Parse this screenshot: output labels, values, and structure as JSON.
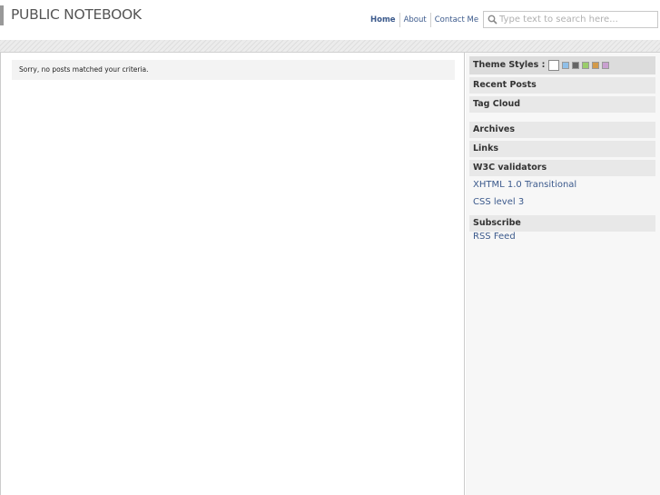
{
  "header": {
    "site_title": "PUBLIC NOTEBOOK",
    "nav": [
      "Home",
      "About",
      "Contact Me"
    ],
    "search_placeholder": "Type text to search here..."
  },
  "content": {
    "notice": "Sorry, no posts matched your criteria."
  },
  "sidebar": {
    "theme_label": "Theme Styles :",
    "theme_swatches": [
      "#ffffff",
      "#8fbfe8",
      "#666666",
      "#9acd6a",
      "#d39a4a",
      "#c9a0d0"
    ],
    "recent_posts": "Recent Posts",
    "tag_cloud": "Tag Cloud",
    "archives": "Archives",
    "links": "Links",
    "w3c": "W3C validators",
    "xhtml": "XHTML 1.0 Transitional",
    "css": "CSS level 3",
    "subscribe": "Subscribe",
    "rss": "RSS Feed"
  }
}
